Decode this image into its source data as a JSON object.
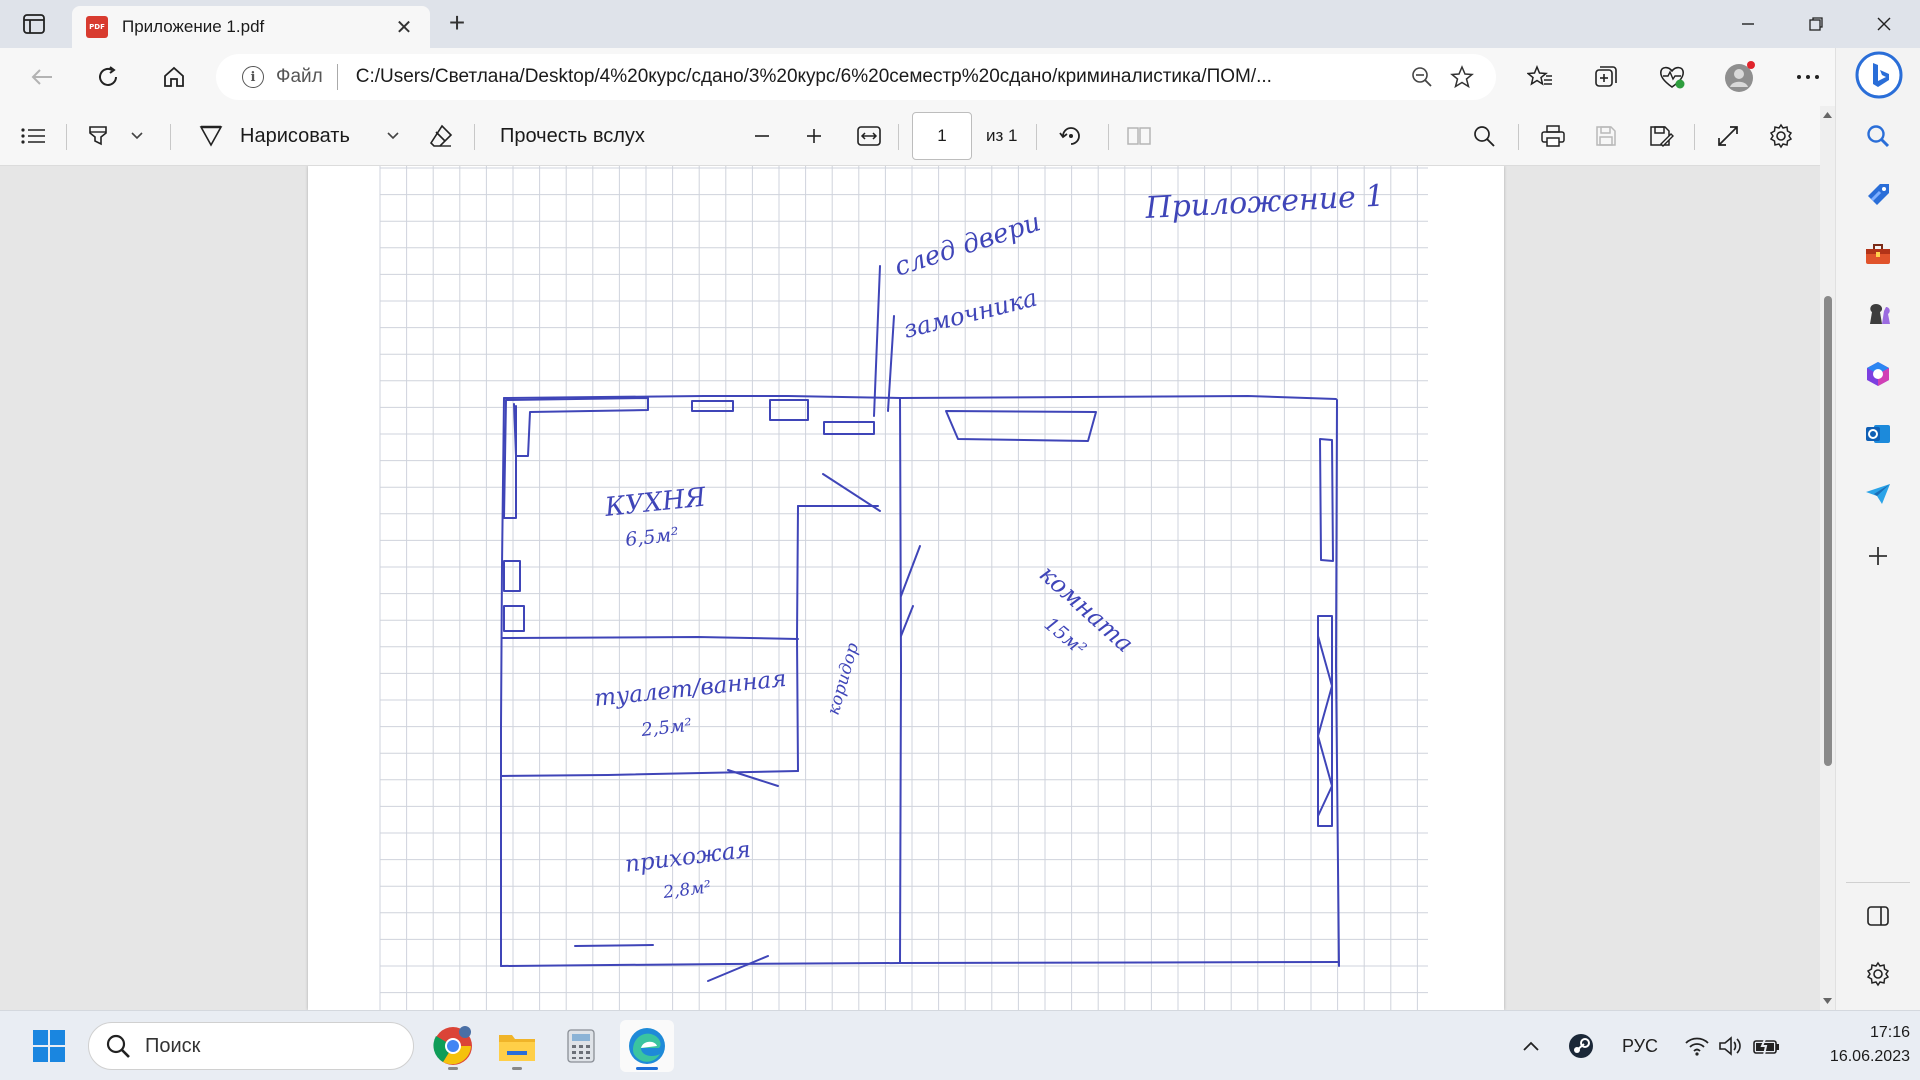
{
  "browser": {
    "tab_title": "Приложение 1.pdf",
    "pdf_badge": "PDF",
    "address_scheme": "Файл",
    "address_url": "C:/Users/Светлана/Desktop/4%20курс/сдано/3%20курс/6%20семестр%20сдано/криминалистика/ПОМ/..."
  },
  "pdf_toolbar": {
    "draw_label": "Нарисовать",
    "read_aloud_label": "Прочесть вслух",
    "page_current": "1",
    "page_total": "из 1"
  },
  "drawing": {
    "title": "Приложение 1",
    "door_trace_line1": "след двери",
    "door_trace_line2": "замочника",
    "kitchen_name": "КУХНЯ",
    "kitchen_area": "6,5м²",
    "room_name": "комната",
    "room_area": "15м²",
    "corridor_name": "коридор",
    "bath_name": "туалет/ванная",
    "bath_area": "2,5м²",
    "hall_name": "прихожая",
    "hall_area": "2,8м²",
    "ink_color": "#3f45b8",
    "grid_color": "#cfd3dc"
  },
  "taskbar": {
    "search_placeholder": "Поиск",
    "lang": "РУС",
    "time": "17:16",
    "date": "16.06.2023"
  },
  "colors": {
    "accent": "#1e6fd9",
    "pdf_red": "#d83b2f"
  }
}
